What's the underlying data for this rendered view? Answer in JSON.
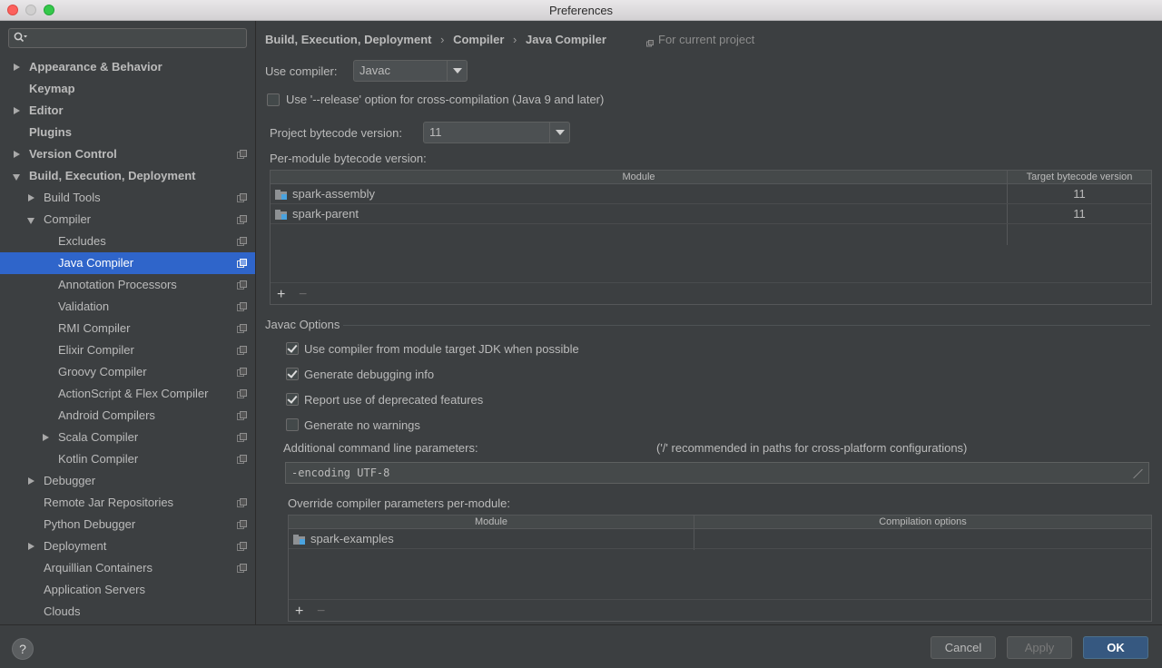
{
  "window": {
    "title": "Preferences"
  },
  "search": {
    "placeholder": ""
  },
  "sidebar": {
    "items": [
      {
        "label": "Appearance & Behavior",
        "bold": true
      },
      {
        "label": "Keymap",
        "bold": true
      },
      {
        "label": "Editor",
        "bold": true
      },
      {
        "label": "Plugins",
        "bold": true
      },
      {
        "label": "Version Control",
        "bold": true
      },
      {
        "label": "Build, Execution, Deployment",
        "bold": true
      },
      {
        "label": "Build Tools"
      },
      {
        "label": "Compiler"
      },
      {
        "label": "Excludes"
      },
      {
        "label": "Java Compiler",
        "selected": true
      },
      {
        "label": "Annotation Processors"
      },
      {
        "label": "Validation"
      },
      {
        "label": "RMI Compiler"
      },
      {
        "label": "Elixir Compiler"
      },
      {
        "label": "Groovy Compiler"
      },
      {
        "label": "ActionScript & Flex Compiler"
      },
      {
        "label": "Android Compilers"
      },
      {
        "label": "Scala Compiler"
      },
      {
        "label": "Kotlin Compiler"
      },
      {
        "label": "Debugger"
      },
      {
        "label": "Remote Jar Repositories"
      },
      {
        "label": "Python Debugger"
      },
      {
        "label": "Deployment"
      },
      {
        "label": "Arquillian Containers"
      },
      {
        "label": "Application Servers"
      },
      {
        "label": "Clouds"
      }
    ]
  },
  "breadcrumb": {
    "parts": [
      "Build, Execution, Deployment",
      "Compiler",
      "Java Compiler"
    ],
    "separator": "›",
    "scope_hint": "For current project"
  },
  "compiler": {
    "use_compiler_label": "Use compiler:",
    "use_compiler_value": "Javac",
    "release_option_label": "Use '--release' option for cross-compilation (Java 9 and later)",
    "release_option_checked": false,
    "project_bytecode_label": "Project bytecode version:",
    "project_bytecode_value": "11",
    "per_module_label": "Per-module bytecode version:"
  },
  "module_table": {
    "columns": [
      "Module",
      "Target bytecode version"
    ],
    "rows": [
      {
        "module": "spark-assembly",
        "version": "11"
      },
      {
        "module": "spark-parent",
        "version": "11"
      }
    ],
    "add": "+",
    "remove": "−"
  },
  "javac": {
    "section_title": "Javac Options",
    "options": [
      {
        "label": "Use compiler from module target JDK when possible",
        "checked": true
      },
      {
        "label": "Generate debugging info",
        "checked": true
      },
      {
        "label": "Report use of deprecated features",
        "checked": true
      },
      {
        "label": "Generate no warnings",
        "checked": false
      }
    ],
    "additional_params_label": "Additional command line parameters:",
    "additional_params_hint": "('/' recommended in paths for cross-platform configurations)",
    "additional_params_value": "-encoding UTF-8",
    "override_label": "Override compiler parameters per-module:"
  },
  "override_table": {
    "columns": [
      "Module",
      "Compilation options"
    ],
    "rows": [
      {
        "module": "spark-examples",
        "options": ""
      }
    ],
    "add": "+",
    "remove": "−"
  },
  "buttons": {
    "help": "?",
    "cancel": "Cancel",
    "apply": "Apply",
    "ok": "OK"
  }
}
